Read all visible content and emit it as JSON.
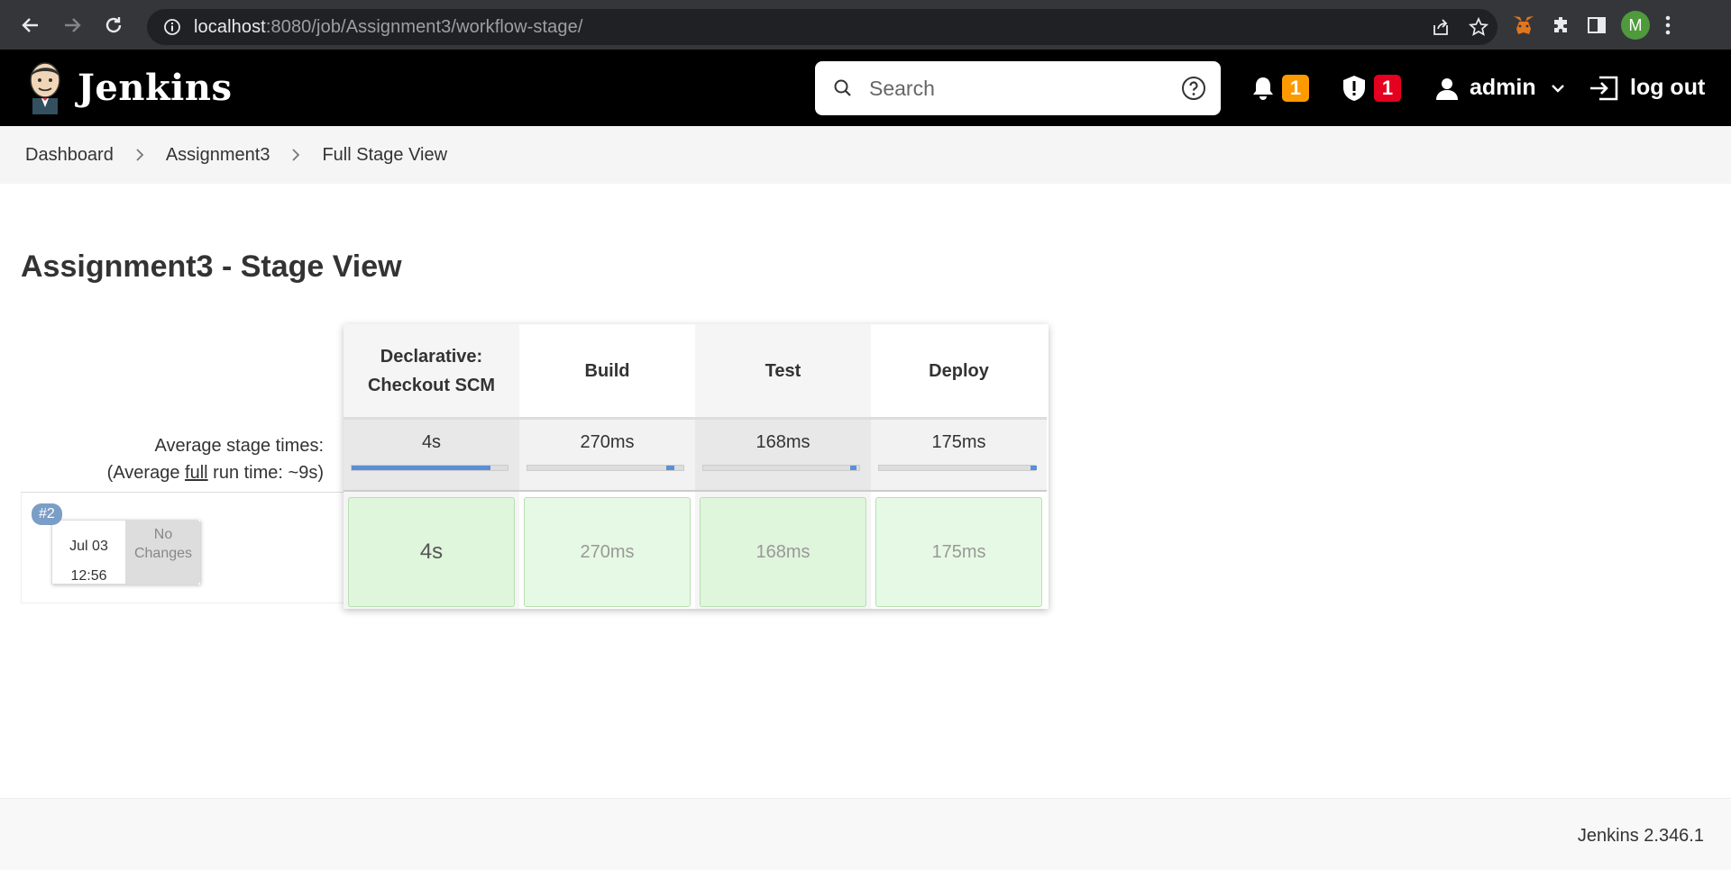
{
  "browser": {
    "url_host": "localhost",
    "url_rest": ":8080/job/Assignment3/workflow-stage/",
    "profile_initial": "M"
  },
  "header": {
    "brand": "Jenkins",
    "search_placeholder": "Search",
    "notifications_count": "1",
    "security_count": "1",
    "user": "admin",
    "logout": "log out"
  },
  "breadcrumb": {
    "items": [
      "Dashboard",
      "Assignment3",
      "Full Stage View"
    ]
  },
  "page": {
    "title": "Assignment3 - Stage View"
  },
  "stage_view": {
    "avg_label_line1": "Average stage times:",
    "avg_label_prefix": "(Average ",
    "avg_label_full": "full",
    "avg_label_suffix": " run time: ~9s)",
    "stages": [
      {
        "name_line1": "Declarative:",
        "name_line2": "Checkout SCM",
        "avg": "4s",
        "run": "4s",
        "bar_start": 0,
        "bar_end": 0.89
      },
      {
        "name_line1": "Build",
        "name_line2": "",
        "avg": "270ms",
        "run": "270ms",
        "bar_start": 0.89,
        "bar_end": 0.94
      },
      {
        "name_line1": "Test",
        "name_line2": "",
        "avg": "168ms",
        "run": "168ms",
        "bar_start": 0.94,
        "bar_end": 0.97
      },
      {
        "name_line1": "Deploy",
        "name_line2": "",
        "avg": "175ms",
        "run": "175ms",
        "bar_start": 0.97,
        "bar_end": 1.0
      }
    ],
    "build": {
      "number": "#2",
      "date": "Jul 03",
      "time": "12:56",
      "changes_line1": "No",
      "changes_line2": "Changes"
    }
  },
  "footer": {
    "version": "Jenkins 2.346.1"
  },
  "colors": {
    "success_cell": "#e6f9e4",
    "bar_fill": "#5b8fd6",
    "notification_badge": "#fe9a00",
    "security_badge": "#e6001f"
  }
}
